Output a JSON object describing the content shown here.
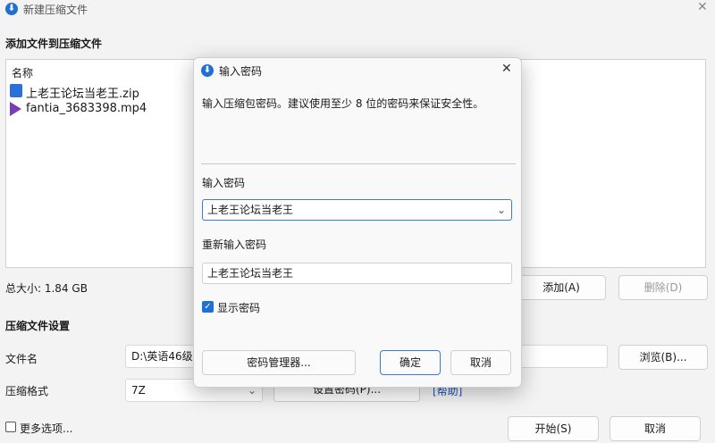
{
  "window": {
    "title": "新建压缩文件"
  },
  "sections": {
    "add_files": "添加文件到压缩文件",
    "settings": "压缩文件设置"
  },
  "file_list": {
    "header": "名称",
    "items": [
      {
        "name": "上老王论坛当老王.zip",
        "icon": "zip-file-icon"
      },
      {
        "name": "fantia_3683398.mp4",
        "icon": "video-file-icon"
      }
    ]
  },
  "total_size": "总大小: 1.84 GB",
  "buttons": {
    "add": "添加(A)",
    "delete": "删除(D)",
    "browse": "浏览(B)...",
    "set_password": "设置密码(P)...",
    "help": "[帮助]",
    "start": "开始(S)",
    "cancel": "取消"
  },
  "fields": {
    "filename_label": "文件名",
    "filename_value": "D:\\英语46级",
    "format_label": "压缩格式",
    "format_value": "7Z"
  },
  "more_options": "更多选项...",
  "dialog": {
    "title": "输入密码",
    "description": "输入压缩包密码。建议使用至少 8 位的密码来保证安全性。",
    "password_label": "输入密码",
    "password_value": "上老王论坛当老王",
    "confirm_label": "重新输入密码",
    "confirm_value": "上老王论坛当老王",
    "show_password": "显示密码",
    "show_password_checked": true,
    "manager_button": "密码管理器...",
    "ok_button": "确定",
    "cancel_button": "取消"
  },
  "colors": {
    "accent": "#1f6fd6",
    "link": "#1f4fb8"
  }
}
